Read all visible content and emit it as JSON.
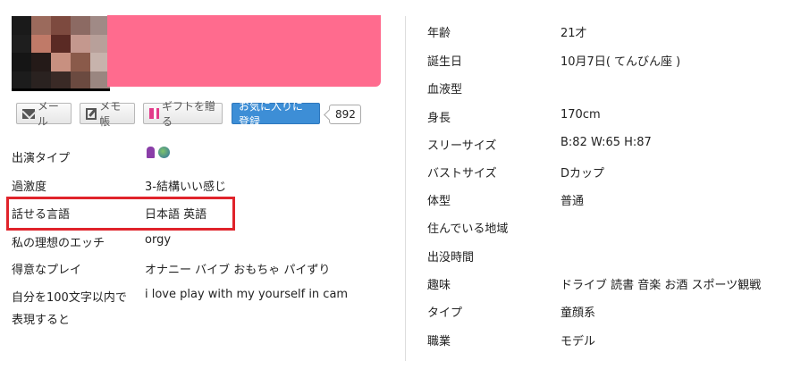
{
  "profile": {
    "avatar_colors": [
      "#1a1a1a",
      "#9b6a5c",
      "#7d4a3f",
      "#8c6a63",
      "#a08a86",
      "#1e1e1e",
      "#c07a68",
      "#5a2a24",
      "#c4988e",
      "#b8a09a",
      "#151515",
      "#241a18",
      "#c89080",
      "#8a5a4a",
      "#c7b3ac",
      "#1c1c1c",
      "#2a2220",
      "#3a2a26",
      "#6b4a40",
      "#9a8680"
    ],
    "redacted_color": "#ff6b8e"
  },
  "actions": {
    "mail_label": "メール",
    "memo_label": "メモ帳",
    "gift_label": "ギフトを贈る",
    "favorite_label": "お気に入りに登録",
    "favorite_count": "892"
  },
  "left_rows": [
    {
      "label": "出演タイプ",
      "value": ""
    },
    {
      "label": "過激度",
      "value": "3-結構いい感じ"
    },
    {
      "label": "話せる言語",
      "value": "日本語  英語"
    },
    {
      "label": "私の理想のエッチ",
      "value": "orgy"
    },
    {
      "label": "得意なプレイ",
      "value": "オナニー  バイブ  おもちゃ  パイずり"
    },
    {
      "label": "自分を100文字以内で",
      "label2": "表現すると",
      "value": "i love play with my yourself in cam"
    }
  ],
  "right_rows": [
    {
      "label": "年齢",
      "value": "21才"
    },
    {
      "label": "誕生日",
      "value": "10月7日( てんびん座 )"
    },
    {
      "label": "血液型",
      "value": ""
    },
    {
      "label": "身長",
      "value": "170cm"
    },
    {
      "label": "スリーサイズ",
      "value": "B:82 W:65 H:87"
    },
    {
      "label": "バストサイズ",
      "value": "Dカップ"
    },
    {
      "label": "体型",
      "value": "普通"
    },
    {
      "label": "住んでいる地域",
      "value": ""
    },
    {
      "label": "出没時間",
      "value": ""
    },
    {
      "label": "趣味",
      "value": "ドライブ  読書  音楽  お酒  スポーツ観戦"
    },
    {
      "label": "タイプ",
      "value": "童顔系"
    },
    {
      "label": "職業",
      "value": "モデル"
    }
  ],
  "highlight_color": "#e0232b"
}
